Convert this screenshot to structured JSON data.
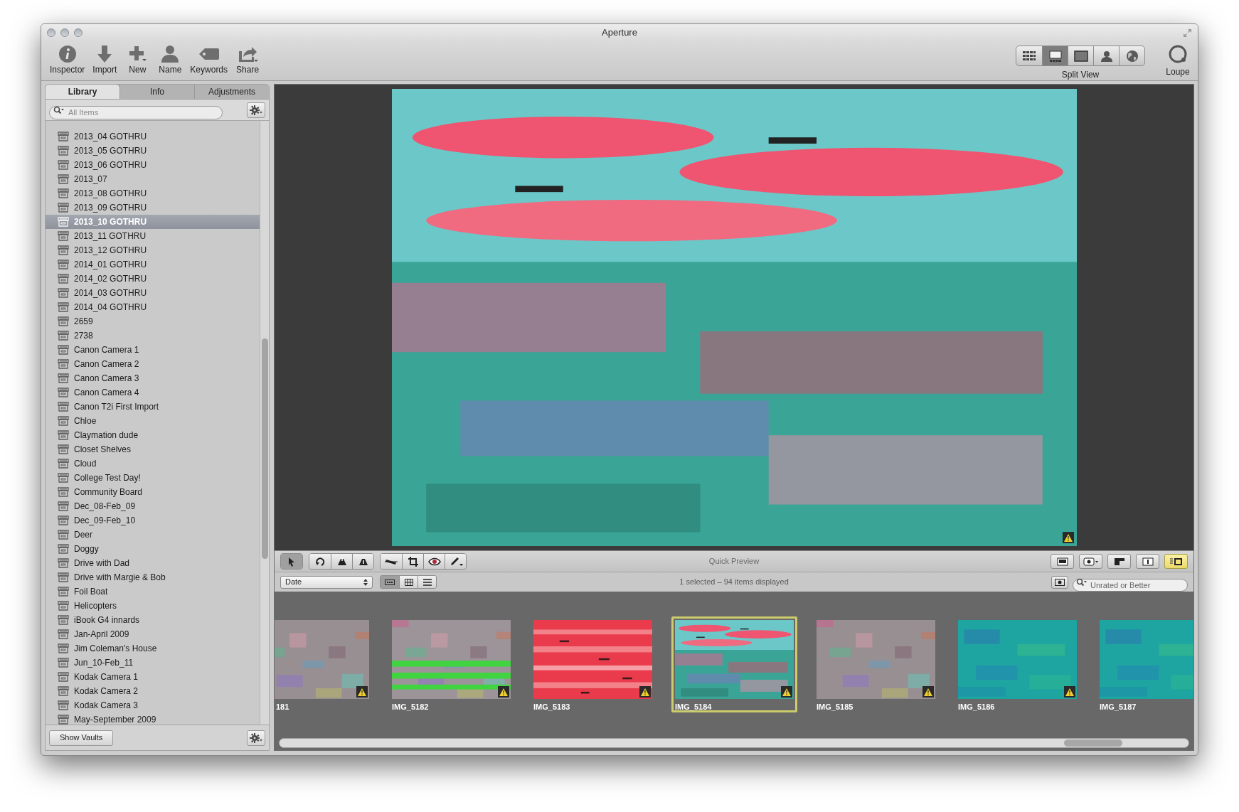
{
  "window": {
    "title": "Aperture"
  },
  "toolbar": {
    "buttons": [
      {
        "label": "Inspector"
      },
      {
        "label": "Import"
      },
      {
        "label": "New"
      },
      {
        "label": "Name"
      },
      {
        "label": "Keywords"
      },
      {
        "label": "Share"
      }
    ],
    "view_buttons": [
      {
        "selected": false
      },
      {
        "selected": true
      },
      {
        "selected": false
      },
      {
        "selected": false
      },
      {
        "selected": false
      }
    ],
    "view_label": "Split View",
    "loupe": {
      "label": "Loupe"
    }
  },
  "inspector": {
    "tabs": [
      {
        "label": "Library",
        "selected": true
      },
      {
        "label": "Info",
        "selected": false
      },
      {
        "label": "Adjustments",
        "selected": false
      }
    ],
    "search": {
      "placeholder": "All Items"
    },
    "projects": [
      {
        "name": "2013_04 GOTHRU",
        "selected": false
      },
      {
        "name": "2013_05 GOTHRU",
        "selected": false
      },
      {
        "name": "2013_06 GOTHRU",
        "selected": false
      },
      {
        "name": "2013_07",
        "selected": false
      },
      {
        "name": "2013_08 GOTHRU",
        "selected": false
      },
      {
        "name": "2013_09 GOTHRU",
        "selected": false
      },
      {
        "name": "2013_10 GOTHRU",
        "selected": true
      },
      {
        "name": "2013_11 GOTHRU",
        "selected": false
      },
      {
        "name": "2013_12 GOTHRU",
        "selected": false
      },
      {
        "name": "2014_01 GOTHRU",
        "selected": false
      },
      {
        "name": "2014_02 GOTHRU",
        "selected": false
      },
      {
        "name": "2014_03 GOTHRU",
        "selected": false
      },
      {
        "name": "2014_04 GOTHRU",
        "selected": false
      },
      {
        "name": "2659",
        "selected": false
      },
      {
        "name": "2738",
        "selected": false
      },
      {
        "name": "Canon Camera 1",
        "selected": false
      },
      {
        "name": "Canon Camera 2",
        "selected": false
      },
      {
        "name": "Canon Camera 3",
        "selected": false
      },
      {
        "name": "Canon Camera 4",
        "selected": false
      },
      {
        "name": "Canon T2i First Import",
        "selected": false
      },
      {
        "name": "Chloe",
        "selected": false
      },
      {
        "name": "Claymation dude",
        "selected": false
      },
      {
        "name": "Closet Shelves",
        "selected": false
      },
      {
        "name": "Cloud",
        "selected": false
      },
      {
        "name": "College Test Day!",
        "selected": false
      },
      {
        "name": "Community Board",
        "selected": false
      },
      {
        "name": "Dec_08-Feb_09",
        "selected": false
      },
      {
        "name": "Dec_09-Feb_10",
        "selected": false
      },
      {
        "name": "Deer",
        "selected": false
      },
      {
        "name": "Doggy",
        "selected": false
      },
      {
        "name": "Drive with Dad",
        "selected": false
      },
      {
        "name": "Drive with Margie & Bob",
        "selected": false
      },
      {
        "name": "Foil Boat",
        "selected": false
      },
      {
        "name": "Helicopters",
        "selected": false
      },
      {
        "name": "iBook G4 innards",
        "selected": false
      },
      {
        "name": "Jan-April 2009",
        "selected": false
      },
      {
        "name": "Jim Coleman's House",
        "selected": false
      },
      {
        "name": "Jun_10-Feb_11",
        "selected": false
      },
      {
        "name": "Kodak Camera 1",
        "selected": false
      },
      {
        "name": "Kodak Camera 2",
        "selected": false
      },
      {
        "name": "Kodak Camera 3",
        "selected": false
      },
      {
        "name": "May-September 2009",
        "selected": false
      }
    ],
    "show_vaults": "Show Vaults"
  },
  "tool_strip": {
    "tools": [
      {
        "selected": true
      },
      {
        "selected": false
      },
      {
        "selected": false
      },
      {
        "selected": false
      },
      {
        "selected": false
      },
      {
        "selected": false
      },
      {
        "selected": false
      },
      {
        "selected": false
      }
    ],
    "title": "Quick Preview",
    "view_tools": [
      {
        "selected": false
      },
      {
        "selected": false
      },
      {
        "selected": false
      },
      {
        "selected": false
      },
      {
        "selected": true
      }
    ]
  },
  "browser_bar": {
    "sort": "Date",
    "layouts": [
      {
        "selected": true
      },
      {
        "selected": false
      },
      {
        "selected": false
      }
    ],
    "status": "1 selected – 94 items displayed",
    "filter": "Unrated or Better"
  },
  "filmstrip": [
    {
      "label": "181",
      "selected": false
    },
    {
      "label": "IMG_5182",
      "selected": false
    },
    {
      "label": "IMG_5183",
      "selected": false
    },
    {
      "label": "IMG_5184",
      "selected": true
    },
    {
      "label": "IMG_5185",
      "selected": false
    },
    {
      "label": "IMG_5186",
      "selected": false
    },
    {
      "label": "IMG_5187",
      "selected": false
    }
  ]
}
